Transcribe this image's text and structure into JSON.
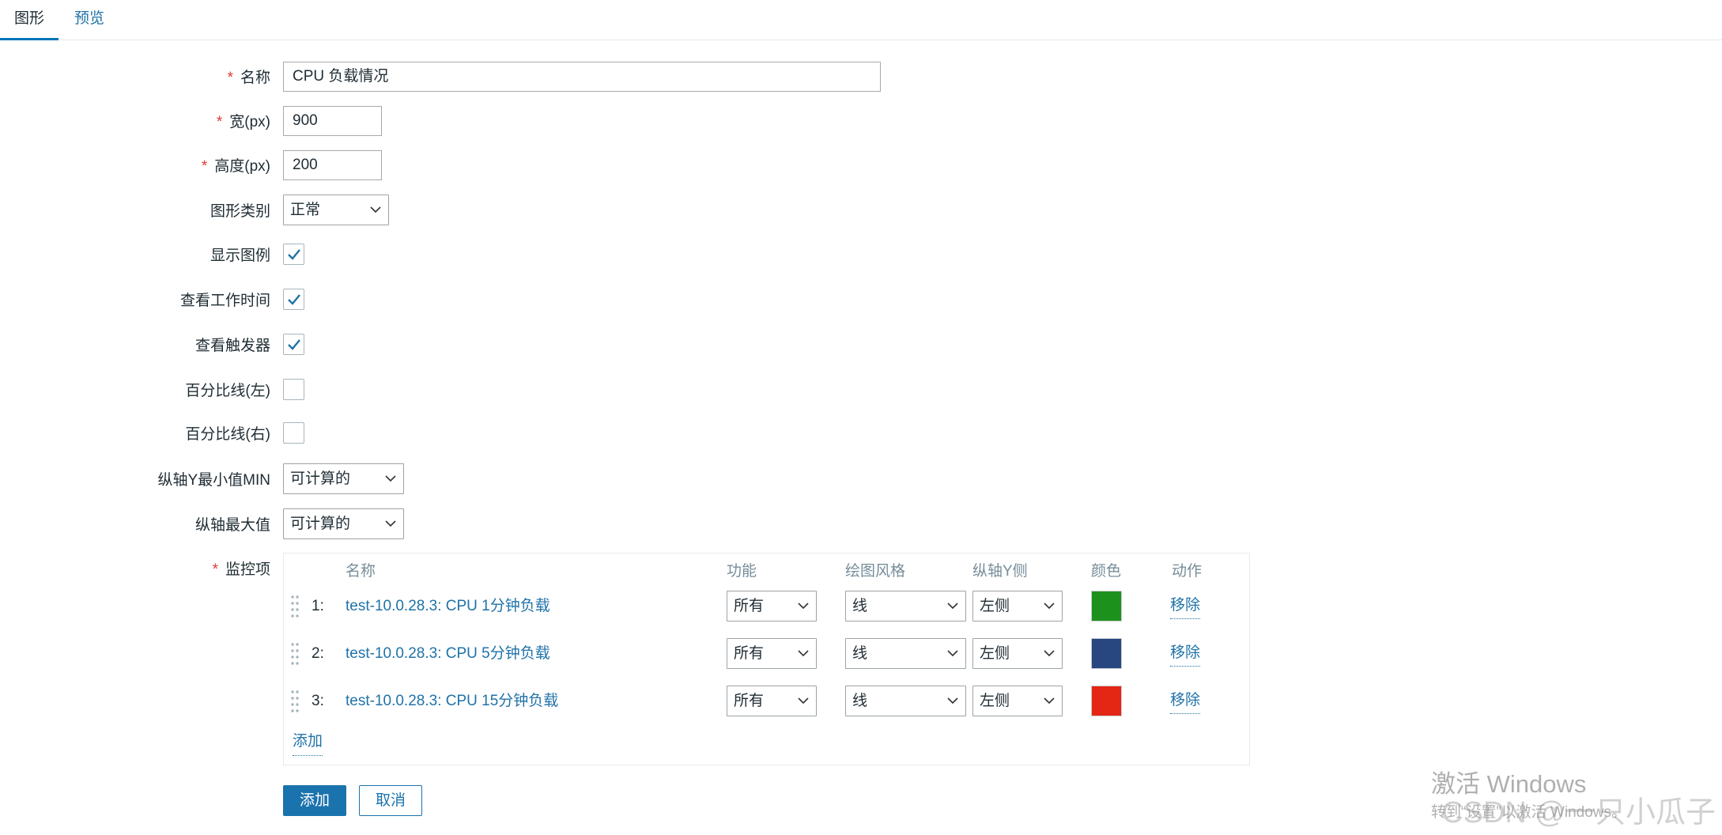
{
  "tabs": [
    {
      "label": "图形",
      "active": true
    },
    {
      "label": "预览",
      "active": false
    }
  ],
  "required_mark": "*",
  "form": {
    "name": {
      "label": "名称",
      "value": "CPU 负载情况"
    },
    "width": {
      "label": "宽(px)",
      "value": "900"
    },
    "height": {
      "label": "高度(px)",
      "value": "200"
    },
    "graph_type": {
      "label": "图形类别",
      "value": "正常"
    },
    "show_legend": {
      "label": "显示图例",
      "checked": true
    },
    "show_work_period": {
      "label": "查看工作时间",
      "checked": true
    },
    "show_triggers": {
      "label": "查看触发器",
      "checked": true
    },
    "percent_left": {
      "label": "百分比线(左)",
      "checked": false
    },
    "percent_right": {
      "label": "百分比线(右)",
      "checked": false
    },
    "ymin": {
      "label": "纵轴Y最小值MIN",
      "value": "可计算的"
    },
    "ymax": {
      "label": "纵轴最大值",
      "value": "可计算的"
    }
  },
  "items": {
    "label": "监控项",
    "columns": [
      "名称",
      "功能",
      "绘图风格",
      "纵轴Y侧",
      "颜色",
      "动作"
    ],
    "rows": [
      {
        "number": "1:",
        "name": "test-10.0.28.3: CPU 1分钟负载",
        "function": "所有",
        "draw_style": "线",
        "y_axis_side": "左侧",
        "color": "#1C911C",
        "action": "移除"
      },
      {
        "number": "2:",
        "name": "test-10.0.28.3: CPU 5分钟负载",
        "function": "所有",
        "draw_style": "线",
        "y_axis_side": "左侧",
        "color": "#28467F",
        "action": "移除"
      },
      {
        "number": "3:",
        "name": "test-10.0.28.3: CPU 15分钟负载",
        "function": "所有",
        "draw_style": "线",
        "y_axis_side": "左侧",
        "color": "#E42614",
        "action": "移除"
      }
    ],
    "add_label": "添加"
  },
  "buttons": {
    "add": "添加",
    "cancel": "取消"
  },
  "watermark": {
    "activate_title": "激活 Windows",
    "activate_hint": "转到“设置”以激活 Windows。",
    "csdn": "CSDN @一只小瓜子"
  },
  "colors": {
    "accent": "#1a73ad",
    "link": "#1f72a8",
    "required": "#e33734"
  },
  "icons": {
    "select_arrow": "chevron-down-icon",
    "checkbox_mark": "check-icon",
    "drag": "drag-handle-icon"
  }
}
